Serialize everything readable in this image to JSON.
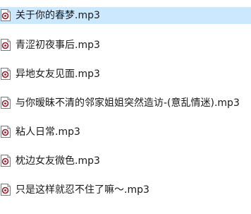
{
  "files": [
    {
      "name": "关于你的春梦.mp3",
      "icon": "audio-file-icon",
      "selected": true
    },
    {
      "name": "青涩初夜事后.mp3",
      "icon": "audio-file-icon",
      "selected": false
    },
    {
      "name": "异地女友见面.mp3",
      "icon": "audio-file-icon",
      "selected": false
    },
    {
      "name": "与你暧昧不清的邻家姐姐突然造访-(意乱情迷).mp3",
      "icon": "audio-file-icon",
      "selected": false
    },
    {
      "name": "粘人日常.mp3",
      "icon": "audio-file-icon",
      "selected": false
    },
    {
      "name": "枕边女友微色.mp3",
      "icon": "audio-file-icon",
      "selected": false
    },
    {
      "name": "只是这样就忍不住了嘛～.mp3",
      "icon": "audio-file-icon",
      "selected": false
    }
  ],
  "colors": {
    "selection": "#cce8ff",
    "icon_accent": "#c0392b"
  }
}
